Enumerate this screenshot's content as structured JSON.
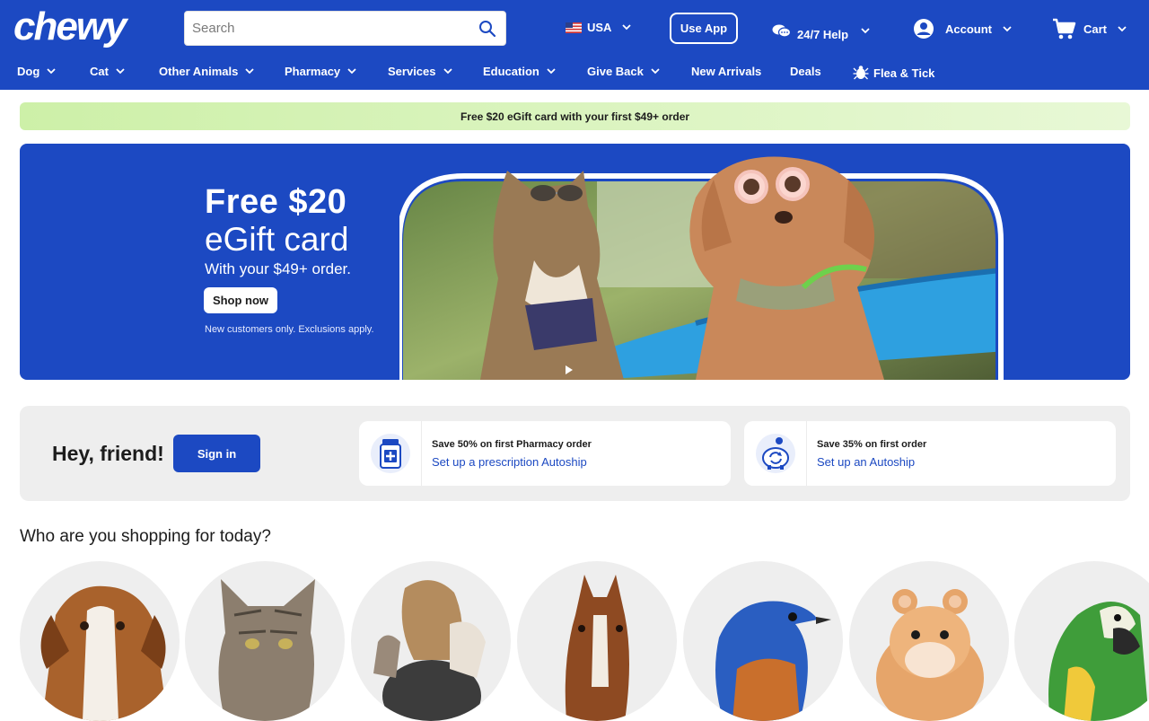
{
  "header": {
    "logo_text": "chewy",
    "search_placeholder": "Search",
    "country": "USA",
    "use_app": "Use App",
    "help": "24/7 Help",
    "account": "Account",
    "cart": "Cart"
  },
  "nav": {
    "items": [
      {
        "label": "Dog",
        "icon": "chevron-down-icon"
      },
      {
        "label": "Cat",
        "icon": "chevron-down-icon"
      },
      {
        "label": "Other Animals",
        "icon": "chevron-down-icon"
      },
      {
        "label": "Pharmacy",
        "icon": "chevron-down-icon"
      },
      {
        "label": "Services",
        "icon": "chevron-down-icon"
      },
      {
        "label": "Education",
        "icon": "chevron-down-icon"
      },
      {
        "label": "Give Back",
        "icon": "chevron-down-icon"
      },
      {
        "label": "New Arrivals"
      },
      {
        "label": "Deals"
      },
      {
        "label": "Flea & Tick",
        "icon": "flea-icon"
      }
    ]
  },
  "promo_strip": {
    "text": "Free $20 eGift card with your first $49+ order"
  },
  "hero": {
    "title": "Free $20",
    "subtitle": "eGift card",
    "line": "With your $49+ order.",
    "button": "Shop now",
    "note": "New customers only. Exclusions apply."
  },
  "signin_panel": {
    "greeting": "Hey, friend!",
    "signin": "Sign in",
    "cards": [
      {
        "title": "Save 50% on first Pharmacy order",
        "link": "Set up a prescription Autoship",
        "icon": "pharmacy-bottle-icon"
      },
      {
        "title": "Save 35% on first order",
        "link": "Set up an Autoship",
        "icon": "autoship-piggy-icon"
      }
    ]
  },
  "shopping": {
    "heading": "Who are you shopping for today?",
    "pets": [
      "dog",
      "cat",
      "person-with-pet",
      "horse",
      "bird",
      "hamster",
      "parrot"
    ]
  },
  "colors": {
    "brand_blue": "#1c49c2",
    "promo_green": "#cdf0a8",
    "panel_gray": "#eeeeee"
  }
}
